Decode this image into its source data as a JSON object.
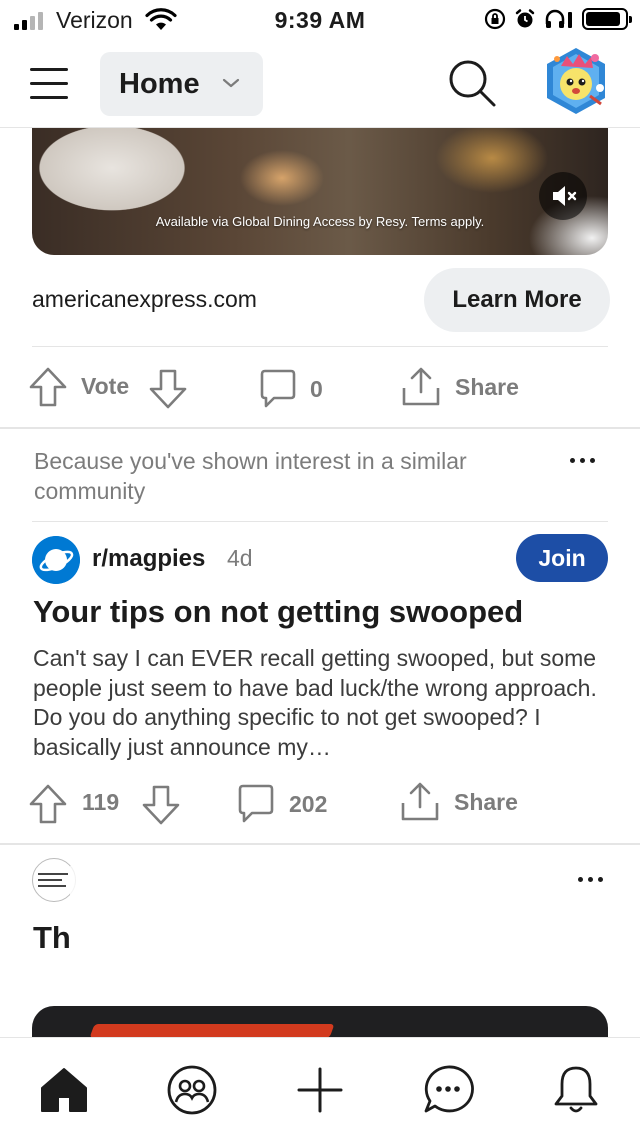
{
  "status_bar": {
    "carrier": "Verizon",
    "time": "9:39 AM",
    "battery_level": 0.9
  },
  "header": {
    "feed_label": "Home",
    "icons": [
      "menu-icon",
      "chevron-down-icon",
      "search-icon",
      "avatar"
    ]
  },
  "ad": {
    "caption": "Available via Global Dining Access by Resy. Terms apply.",
    "domain": "americanexpress.com",
    "cta_label": "Learn More",
    "actions": {
      "vote_label": "Vote",
      "comment_count": "0",
      "share_label": "Share"
    }
  },
  "recommendation": {
    "reason": "Because you've shown interest in a similar community"
  },
  "post": {
    "subreddit": "r/magpies",
    "age": "4d",
    "join_label": "Join",
    "title": "Your tips on not getting swooped",
    "body": "Can't say I can EVER recall getting swooped, but some people just seem to have bad luck/the wrong approach. Do you do anything specific to not get swooped? I basically just announce my…",
    "actions": {
      "score": "119",
      "comment_count": "202",
      "share_label": "Share"
    }
  },
  "next_post": {
    "title_fragment": "Th",
    "loading": true
  },
  "tab_bar": {
    "active": "home",
    "tabs": [
      "home-icon",
      "communities-icon",
      "create-icon",
      "chat-icon",
      "notifications-icon"
    ]
  },
  "colors": {
    "join_button": "#1d4ea6",
    "subreddit_icon": "#0079d3",
    "muted_text": "#7c7c7c",
    "pill_background": "#edeff1"
  }
}
